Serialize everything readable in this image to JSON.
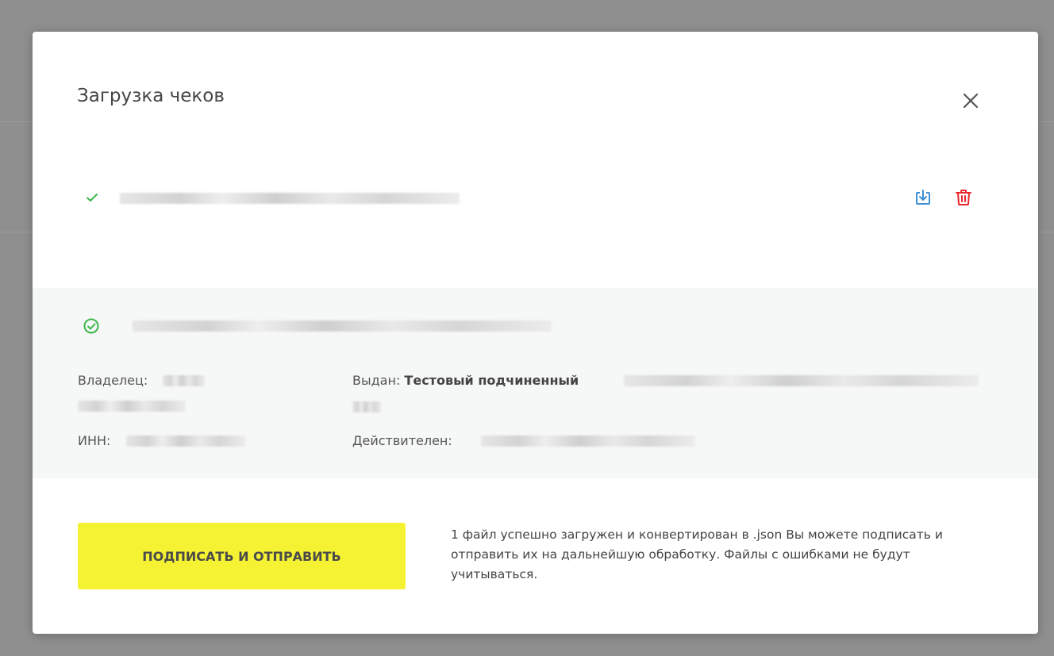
{
  "modal": {
    "title": "Загрузка чеков",
    "close_icon": "close-icon"
  },
  "file": {
    "status_icon": "check-icon",
    "status_color": "#3cb54a",
    "name": "",
    "download_icon": "download-icon",
    "download_color": "#3d8fd6",
    "delete_icon": "trash-icon",
    "delete_color": "#e8262b"
  },
  "certificate": {
    "status_icon": "check-circle-icon",
    "status_color": "#3cb54a",
    "owner_label": "Владелец:",
    "inn_label": "ИНН:",
    "issued_label": "Выдан:",
    "issued_value": "Тестовый подчиненный",
    "valid_label": "Действителен:"
  },
  "actions": {
    "sign_button_label": "ПОДПИСАТЬ И ОТПРАВИТЬ",
    "sign_button_color": "#f4f233"
  },
  "info": {
    "message": "1 файл успешно загружен и конвертирован в .json Вы можете подписать и отправить их на дальнейшую обработку. Файлы с ошибками не будут учитываться."
  }
}
